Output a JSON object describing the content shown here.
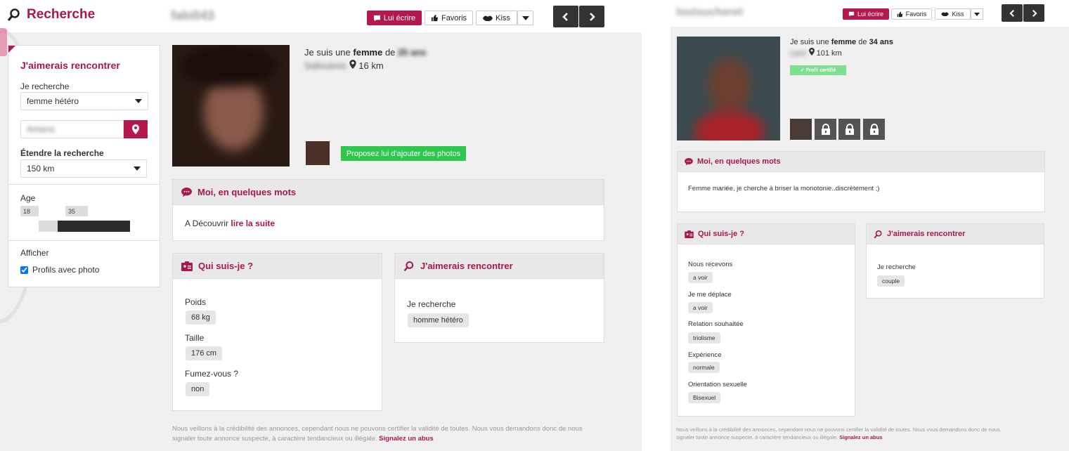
{
  "left": {
    "header": {
      "search_title": "Recherche",
      "username": "fabi043",
      "write_label": "Lui écrire",
      "favorites_label": "Favoris",
      "kiss_label": "Kiss"
    },
    "sidebar": {
      "title": "J'aimerais rencontrer",
      "looking_for_label": "Je recherche",
      "looking_for_value": "femme hétéro",
      "location_value": "Amiens",
      "extend_label": "Étendre la recherche",
      "extend_value": "150 km",
      "age_label": "Age",
      "age_min": "18",
      "age_max": "35",
      "show_label": "Afficher",
      "photo_only_label": "Profils avec photo"
    },
    "profile": {
      "intro_prefix": "Je suis une",
      "gender": "femme",
      "age_connector": "de",
      "age": "25 ans",
      "city": "Salloubois",
      "distance": "16 km",
      "suggest_photos_label": "Proposez lui d'ajouter des photos"
    },
    "about": {
      "title": "Moi, en quelques mots",
      "text": "A Découvrir",
      "read_more": "lire la suite"
    },
    "who_am_i": {
      "title": "Qui suis-je ?",
      "fields": [
        {
          "label": "Poids",
          "value": "68 kg"
        },
        {
          "label": "Taille",
          "value": "176 cm"
        },
        {
          "label": "Fumez-vous ?",
          "value": "non"
        }
      ]
    },
    "would_like": {
      "title": "J'aimerais rencontrer",
      "label": "Je recherche",
      "value": "homme hétéro"
    },
    "disclaimer": {
      "line1": "Nous veillons à la crédibilité des annonces, cependant nous ne pouvons certifier la validité de toutes. Nous vous demandons donc de nous",
      "line2": "signaler toute annonce suspecte, à caractère tendancieux ou illégale.",
      "report_label": "Signalez un abus"
    }
  },
  "right": {
    "header": {
      "username": "louisucheret",
      "write_label": "Lui écrire",
      "favorites_label": "Favoris",
      "kiss_label": "Kiss"
    },
    "profile": {
      "intro_prefix": "Je suis une",
      "gender": "femme",
      "age_connector": "de",
      "age": "34 ans",
      "city": "Lyon",
      "distance": "101 km",
      "certified_label": "✓ Profil certifié"
    },
    "about": {
      "title": "Moi, en quelques mots",
      "text": "Femme mariée, je cherche à briser la monotonie..discrètement ;)"
    },
    "who_am_i": {
      "title": "Qui suis-je ?",
      "fields": [
        {
          "label": "Nous recevons",
          "value": "a voir"
        },
        {
          "label": "Je me déplace",
          "value": "a voir"
        },
        {
          "label": "Relation souhaitée",
          "value": "triolisme"
        },
        {
          "label": "Expérience",
          "value": "normale"
        },
        {
          "label": "Orientation sexuelle",
          "value": "Bisexuel"
        }
      ]
    },
    "would_like": {
      "title": "J'aimerais rencontrer",
      "label": "Je recherche",
      "value": "couple"
    },
    "disclaimer": {
      "line1": "Nous veillons à la crédibilité des annonces, cependant nous ne pouvons certifier la validité de toutes. Nous vous demandons donc de nous",
      "line2": "signaler toute annonce suspecte, à caractère tendancieux ou illégale.",
      "report_label": "Signalez un abus"
    }
  },
  "colors": {
    "brand": "#b5174f",
    "green": "#2dc84d",
    "dark_button": "#333333"
  },
  "icons": [
    "search-icon",
    "chat-bubble-icon",
    "thumbs-up-icon",
    "lips-icon",
    "chevron-down-icon",
    "chevron-left-icon",
    "chevron-right-icon",
    "map-pin-icon",
    "id-card-icon",
    "lock-icon",
    "checkmark-icon"
  ]
}
